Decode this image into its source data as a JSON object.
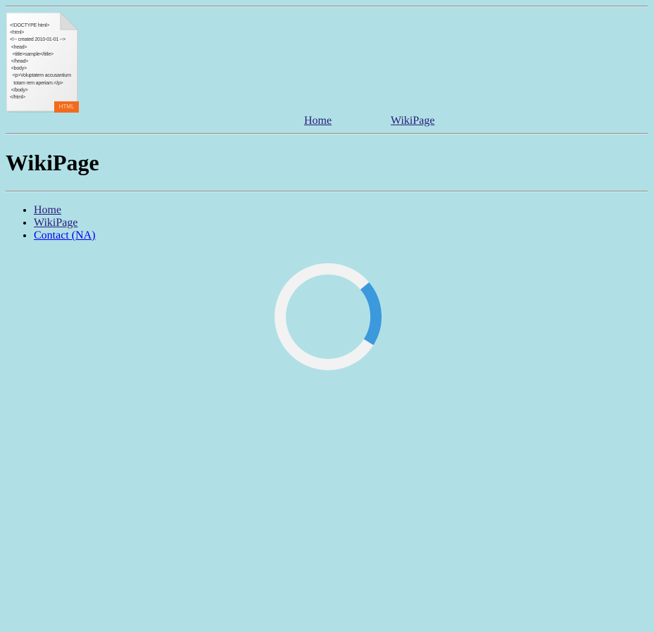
{
  "header": {
    "logo": {
      "code_lines": [
        "<!DOCTYPE html>",
        "<html>",
        "<!-- created 2010-01-01 -->",
        "<head>",
        "<title>sample</title>",
        "</head>",
        "<body>",
        "<p>Voluptatem accusantium",
        "totam rem aperiam.</p>",
        "</body>",
        "</html>"
      ],
      "badge": "HTML"
    },
    "nav": {
      "home": "Home",
      "wiki": "WikiPage"
    }
  },
  "main": {
    "title": "WikiPage",
    "links": [
      {
        "label": "Home"
      },
      {
        "label": "WikiPage"
      },
      {
        "label": "Contact (NA)"
      }
    ]
  },
  "spinner": {
    "track_color": "#f2f2f2",
    "accent_color": "#3b99dc",
    "progress": 0.2
  },
  "colors": {
    "background": "#b0e0e6",
    "visited_link": "#2a1a7a",
    "link": "#0000ee"
  }
}
